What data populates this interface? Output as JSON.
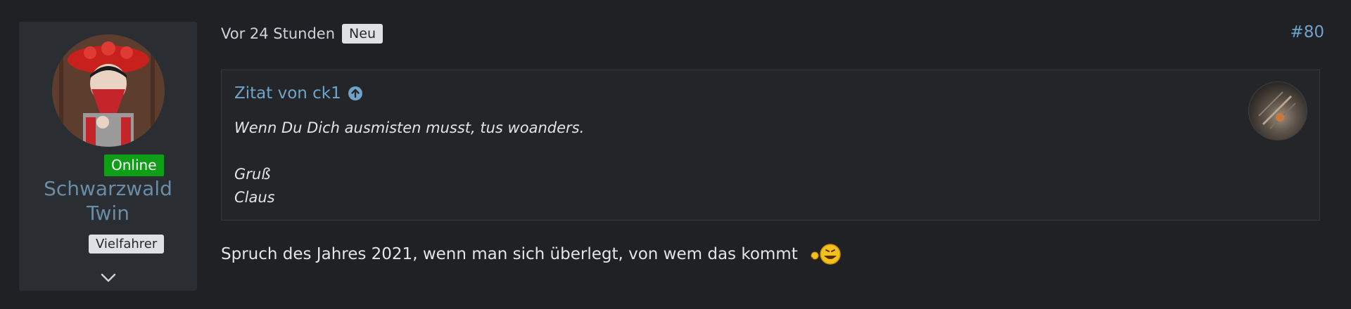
{
  "user": {
    "online_label": "Online",
    "name_line1": "Schwarzwald",
    "name_line2": "Twin",
    "rank": "Vielfahrer"
  },
  "post": {
    "time": "Vor 24 Stunden",
    "new_label": "Neu",
    "number": "#80",
    "quote": {
      "header": "Zitat von ck1",
      "line1": "Wenn Du Dich ausmisten musst, tus woanders.",
      "line2": "Gruß",
      "line3": "Claus"
    },
    "message": "Spruch des Jahres 2021, wenn man sich überlegt, von wem das kommt"
  },
  "colors": {
    "background": "#1f2124",
    "panel": "#2a2d31",
    "link": "#6fa3c9",
    "username": "#6b8ca6",
    "online": "#0e9f16"
  },
  "icons": {
    "expand": "chevron-down-icon",
    "quote_jump": "arrow-up-circle-icon",
    "smiley": "laughing-smiley-icon"
  }
}
